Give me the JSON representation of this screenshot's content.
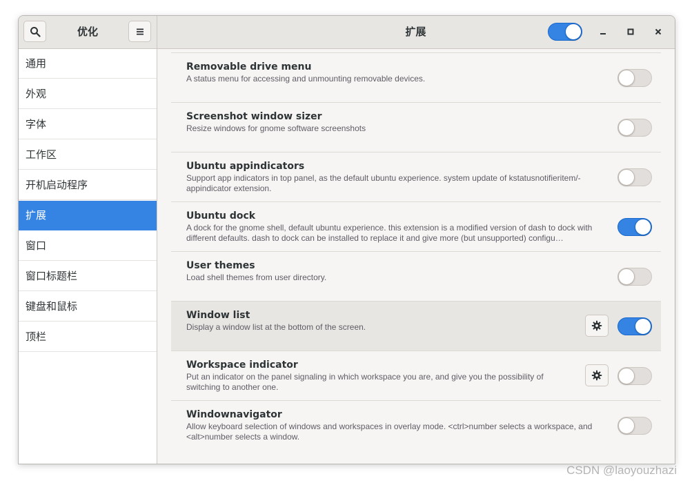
{
  "sidebar_header": {
    "title": "优化"
  },
  "header": {
    "title": "扩展",
    "global_switch_on": true
  },
  "sidebar": {
    "items": [
      {
        "label": "通用",
        "selected": false
      },
      {
        "label": "外观",
        "selected": false
      },
      {
        "label": "字体",
        "selected": false
      },
      {
        "label": "工作区",
        "selected": false
      },
      {
        "label": "开机启动程序",
        "selected": false
      },
      {
        "label": "扩展",
        "selected": true
      },
      {
        "label": "窗口",
        "selected": false
      },
      {
        "label": "窗口标题栏",
        "selected": false
      },
      {
        "label": "键盘和鼠标",
        "selected": false
      },
      {
        "label": "顶栏",
        "selected": false
      }
    ]
  },
  "extensions": [
    {
      "name": "Removable drive menu",
      "description": "A status menu for accessing and unmounting removable devices.",
      "enabled": false,
      "has_settings": false,
      "highlighted": false
    },
    {
      "name": "Screenshot window sizer",
      "description": "Resize windows for gnome software screenshots",
      "enabled": false,
      "has_settings": false,
      "highlighted": false
    },
    {
      "name": "Ubuntu appindicators",
      "description": "Support app indicators in top panel, as the default ubuntu experience. system update of kstatusnotifieritem/-appindicator extension.",
      "enabled": false,
      "has_settings": false,
      "highlighted": false
    },
    {
      "name": "Ubuntu dock",
      "description": "A dock for the gnome shell, default ubuntu experience. this extension is a modified version of dash to dock with different defaults. dash to dock can be installed to replace it and give more (but unsupported) configu…",
      "enabled": true,
      "has_settings": false,
      "highlighted": false
    },
    {
      "name": "User themes",
      "description": "Load shell themes from user directory.",
      "enabled": false,
      "has_settings": false,
      "highlighted": false
    },
    {
      "name": "Window list",
      "description": "Display a window list at the bottom of the screen.",
      "enabled": true,
      "has_settings": true,
      "highlighted": true
    },
    {
      "name": "Workspace indicator",
      "description": "Put an indicator on the panel signaling in which workspace you are, and give you the possibility of switching to another one.",
      "enabled": false,
      "has_settings": true,
      "highlighted": false
    },
    {
      "name": "Windownavigator",
      "description": "Allow keyboard selection of windows and workspaces in overlay mode. <ctrl>number selects a workspace, and <alt>number selects a window.",
      "enabled": false,
      "has_settings": false,
      "highlighted": false
    }
  ],
  "icons": {
    "search": "search-icon",
    "menu": "hamburger-menu-icon",
    "minimize": "minimize-icon",
    "maximize": "maximize-icon",
    "close": "close-icon",
    "settings": "gear-icon"
  },
  "colors": {
    "accent": "#3584e4",
    "sidebar_bg": "#ffffff",
    "content_bg": "#f6f5f4",
    "headerbar_bg": "#e8e6e3"
  },
  "watermark": "CSDN @laoyouzhazi"
}
